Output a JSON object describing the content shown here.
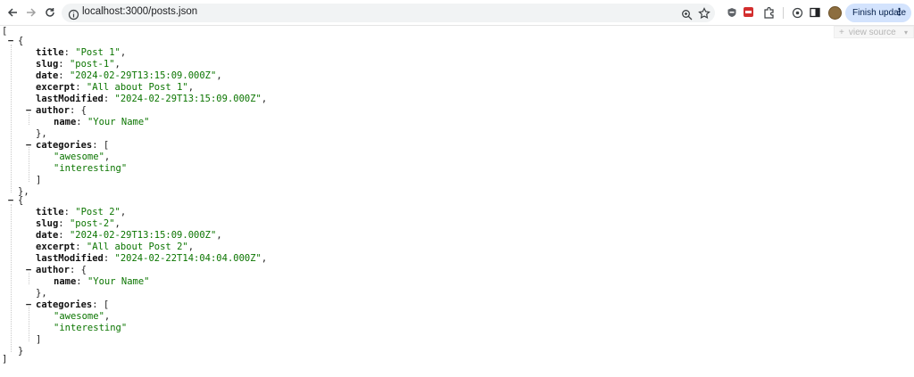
{
  "browser": {
    "url": "localhost:3000/posts.json",
    "update_button_label": "Finish update"
  },
  "viewer": {
    "view_source_label": "view source",
    "view_source_plus": "+",
    "view_source_arrow": "▾"
  },
  "punct": {
    "open_bracket": "[",
    "close_bracket": "]",
    "open_brace": "{",
    "close_brace": "}",
    "close_brace_comma": "},",
    "collapse": "−"
  },
  "keys": {
    "title": "title",
    "slug": "slug",
    "date": "date",
    "excerpt": "excerpt",
    "lastModified": "lastModified",
    "author": "author",
    "name": "name",
    "categories": "categories"
  },
  "posts": [
    {
      "title": "\"Post 1\"",
      "slug": "\"post-1\"",
      "date": "\"2024-02-29T13:15:09.000Z\"",
      "excerpt": "\"All about Post 1\"",
      "lastModified": "\"2024-02-29T13:15:09.000Z\"",
      "author_name": "\"Your Name\"",
      "categories": [
        "\"awesome\"",
        "\"interesting\""
      ]
    },
    {
      "title": "\"Post 2\"",
      "slug": "\"post-2\"",
      "date": "\"2024-02-29T13:15:09.000Z\"",
      "excerpt": "\"All about Post 2\"",
      "lastModified": "\"2024-02-22T14:04:04.000Z\"",
      "author_name": "\"Your Name\"",
      "categories": [
        "\"awesome\"",
        "\"interesting\""
      ]
    }
  ]
}
